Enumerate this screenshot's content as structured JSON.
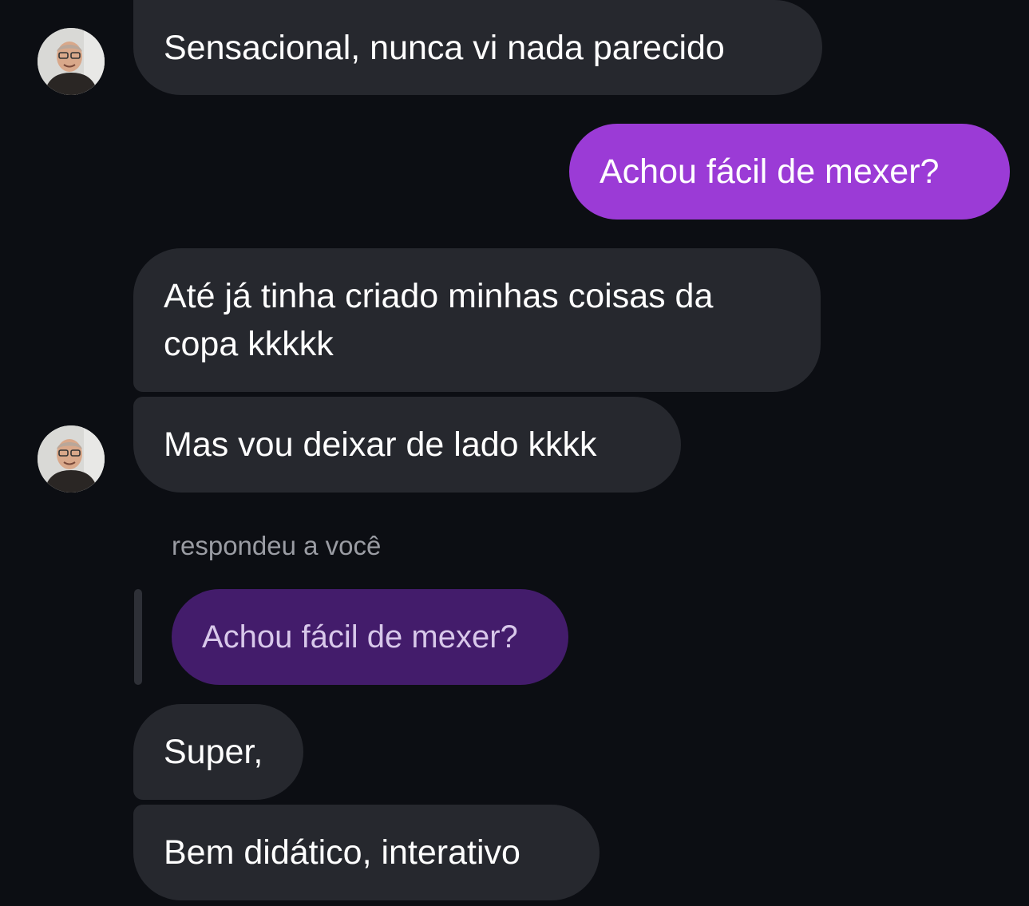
{
  "conversation": {
    "messages": [
      {
        "sender": "other",
        "text": "Sensacional, nunca vi nada parecido"
      },
      {
        "sender": "me",
        "text": "Achou fácil de mexer?"
      },
      {
        "sender": "other",
        "text": "Até já tinha criado minhas coisas da copa kkkkk"
      },
      {
        "sender": "other",
        "text": "Mas vou deixar de lado kkkk"
      },
      {
        "sender": "other",
        "reply_label": "respondeu a você",
        "quoted_text": "Achou fácil de mexer?"
      },
      {
        "sender": "other",
        "text": "Super,"
      },
      {
        "sender": "other",
        "text": "Bem didático, interativo"
      }
    ]
  },
  "colors": {
    "background": "#0c0e13",
    "received_bubble": "#26282e",
    "sent_bubble": "#9b3bd6",
    "quoted_bubble": "#431c6b"
  },
  "icons": {
    "avatar": "user-avatar-photo"
  }
}
